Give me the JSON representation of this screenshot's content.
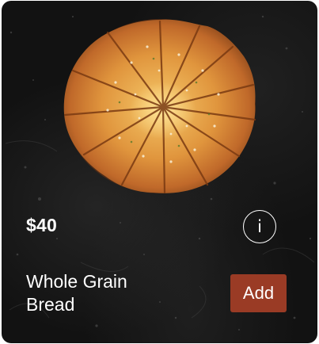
{
  "product": {
    "price": "$40",
    "name_line1": "Whole Grain",
    "name_line2": "Bread",
    "image_icon": "round-pastry-pie"
  },
  "actions": {
    "info_label": "i",
    "add_label": "Add"
  },
  "colors": {
    "card_background": "#121212",
    "add_button": "#9a3b25",
    "text": "#ffffff"
  }
}
